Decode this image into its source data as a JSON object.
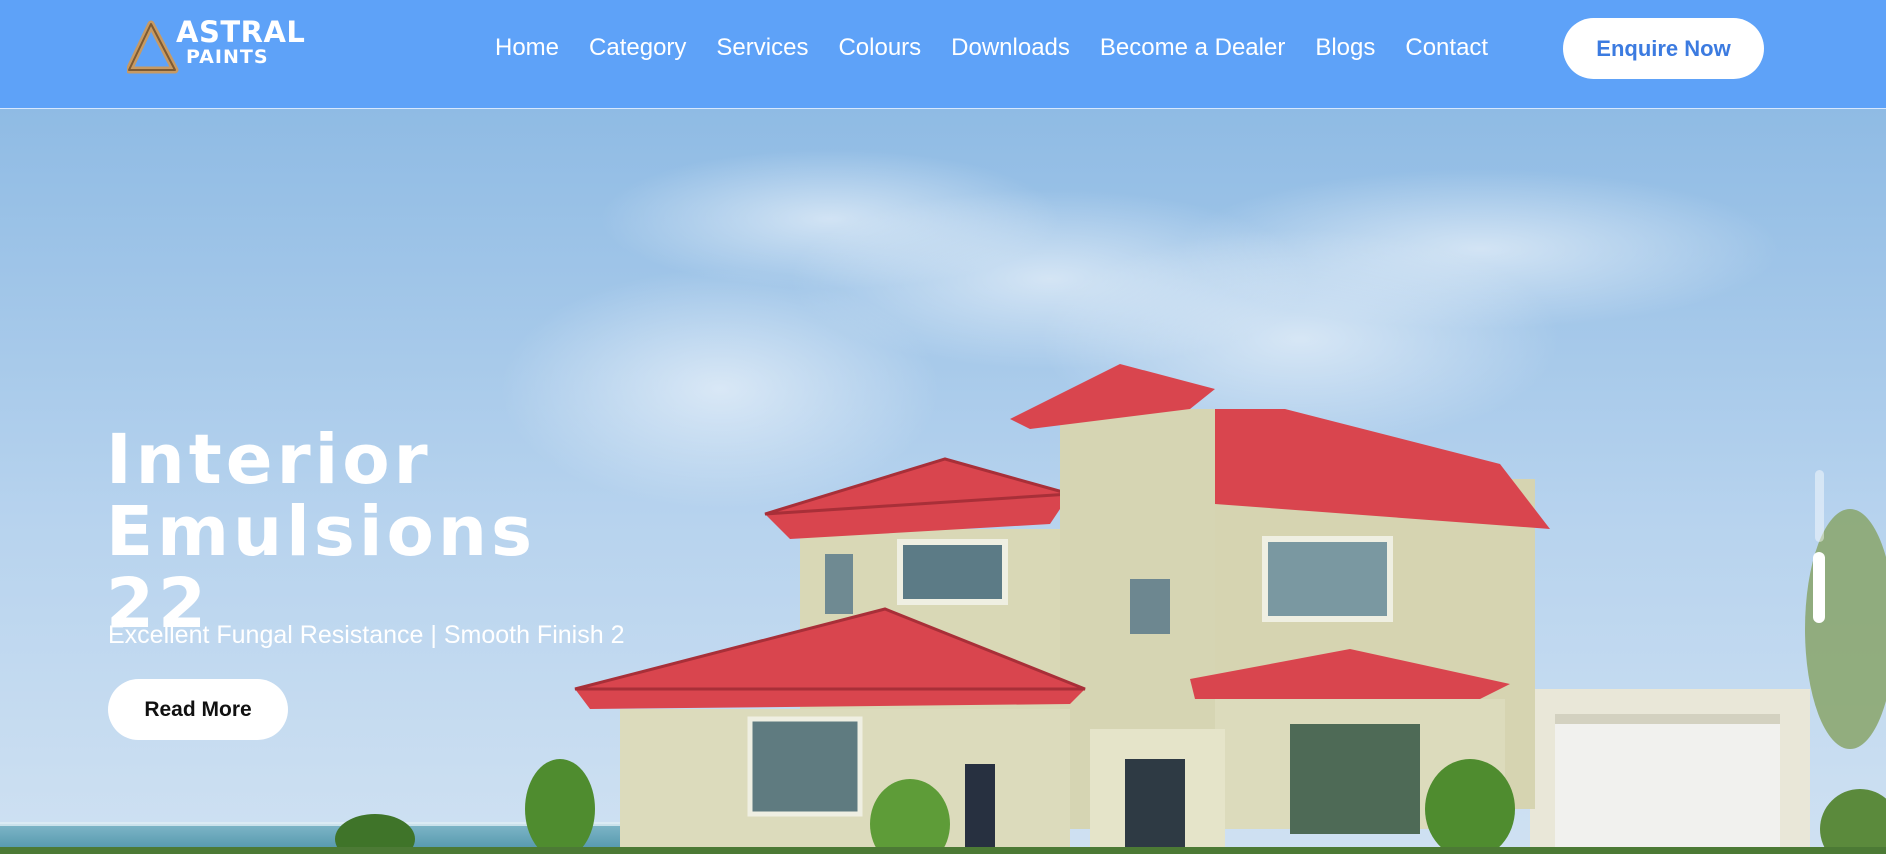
{
  "brand": {
    "name_line1": "ASTRAL",
    "name_line2": "PAINTS"
  },
  "nav": {
    "items": [
      "Home",
      "Category",
      "Services",
      "Colours",
      "Downloads",
      "Become a Dealer",
      "Blogs",
      "Contact"
    ],
    "cta_label": "Enquire Now"
  },
  "hero": {
    "title_line1": "Interior",
    "title_line2": "Emulsions",
    "title_line3": "22",
    "subtitle": "Excellent Fungal Resistance | Smooth Finish 2",
    "button_label": "Read More"
  },
  "slider": {
    "total_slides": 2,
    "active_slide": 2
  },
  "colors": {
    "header_bg": "#5ea2f8",
    "cta_text": "#3c7be0",
    "roof_red": "#d9454e",
    "wall_cream": "#d9d8b6"
  },
  "icons": {
    "logo": "astral-triangle-logo-icon"
  }
}
